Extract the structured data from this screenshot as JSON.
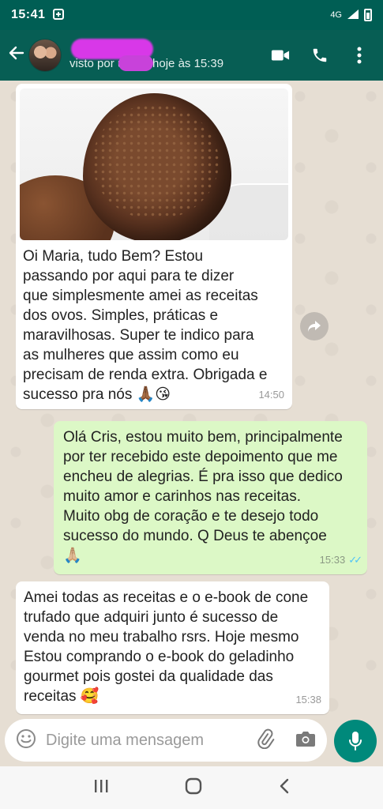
{
  "status_bar": {
    "time": "15:41",
    "network": "4G"
  },
  "header": {
    "last_seen": "visto por último hoje às 15:39"
  },
  "messages": [
    {
      "direction": "incoming",
      "has_image": true,
      "text": "Oi Maria, tudo Bem? Estou\npassando por aqui para te dizer\nque simplesmente amei as receitas\ndos ovos. Simples, práticas e\nmaravilhosas. Super te indico para\nas mulheres que assim como eu\nprecisam de renda extra. Obrigada e\nsucesso pra nós",
      "emoji": "🙏🏾😘",
      "time": "14:50"
    },
    {
      "direction": "outgoing",
      "text": "Olá Cris, estou muito bem, principalmente\npor ter recebido este depoimento que me\nencheu de alegrias. É pra isso que dedico\nmuito amor e carinhos nas receitas.\nMuito obg de coração e te desejo todo\nsucesso do mundo. Q Deus te abençoe",
      "emoji": "🙏🏼",
      "time": "15:33"
    },
    {
      "direction": "incoming",
      "text": "Amei todas as receitas e o e-book de cone\ntrufado que adquiri junto é sucesso de\nvenda no meu trabalho rsrs. Hoje mesmo\nEstou comprando o e-book do geladinho\ngourmet pois gostei da qualidade das\nreceitas",
      "emoji": "🥰",
      "time": "15:38"
    }
  ],
  "composer": {
    "placeholder": "Digite uma mensagem"
  },
  "colors": {
    "header": "#075e54",
    "outgoing_bubble": "#dcf8c6",
    "incoming_bubble": "#ffffff",
    "read_ticks": "#4fc3f7",
    "mic_button": "#00897b",
    "chat_background": "#e6ded3"
  },
  "icons": [
    "back-arrow-icon",
    "video-call-icon",
    "phone-icon",
    "more-options-icon",
    "forward-icon",
    "emoji-icon",
    "attach-icon",
    "camera-icon",
    "mic-icon",
    "recent-apps-icon",
    "home-icon",
    "nav-back-icon"
  ]
}
